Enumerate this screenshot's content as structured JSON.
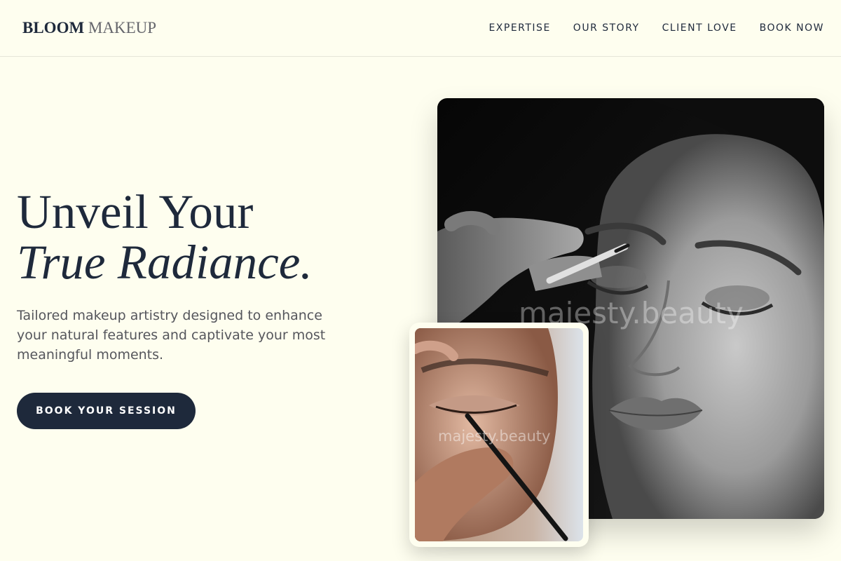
{
  "header": {
    "logo_strong": "BLOOM",
    "logo_light": "MAKEUP",
    "nav": [
      "EXPERTISE",
      "OUR STORY",
      "CLIENT LOVE",
      "BOOK NOW"
    ]
  },
  "hero": {
    "headline_line1": "Unveil Your",
    "headline_line2": "True Radiance.",
    "subtitle": "Tailored makeup artistry designed to enhance your natural features and captivate your most meaningful moments.",
    "cta_label": "BOOK YOUR SESSION"
  },
  "images": {
    "main_watermark": "majesty.beauty",
    "inset_watermark": "majesty.beauty"
  },
  "colors": {
    "background": "#fefeef",
    "primary": "#1e293b",
    "text_muted": "#55565c"
  }
}
